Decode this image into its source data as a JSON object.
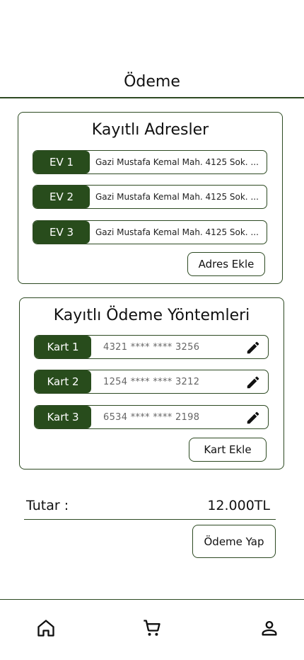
{
  "header": {
    "title": "Ödeme"
  },
  "addresses": {
    "title": "Kayıtlı Adresler",
    "items": [
      {
        "label": "EV 1",
        "text": "Gazi Mustafa Kemal Mah. 4125 Sok. ..."
      },
      {
        "label": "EV 2",
        "text": "Gazi Mustafa Kemal Mah. 4125 Sok. ..."
      },
      {
        "label": "EV 3",
        "text": "Gazi Mustafa Kemal Mah. 4125 Sok. ..."
      }
    ],
    "add_label": "Adres Ekle"
  },
  "payments": {
    "title": "Kayıtlı Ödeme Yöntemleri",
    "items": [
      {
        "label": "Kart 1",
        "number": "4321 **** **** 3256",
        "icon": "pencil-icon"
      },
      {
        "label": "Kart 2",
        "number": "1254 **** **** 3212",
        "icon": "pencil-icon"
      },
      {
        "label": "Kart 3",
        "number": "6534 **** **** 2198",
        "icon": "pencil-icon"
      }
    ],
    "add_label": "Kart Ekle"
  },
  "total": {
    "label": "Tutar :",
    "value": "12.000TL"
  },
  "pay_button": {
    "label": "Ödeme Yap"
  },
  "nav": {
    "items": [
      "home-icon",
      "cart-icon",
      "profile-icon"
    ]
  },
  "colors": {
    "accent": "#284c1c",
    "border": "#2d4a22",
    "background": "#ffffff"
  }
}
